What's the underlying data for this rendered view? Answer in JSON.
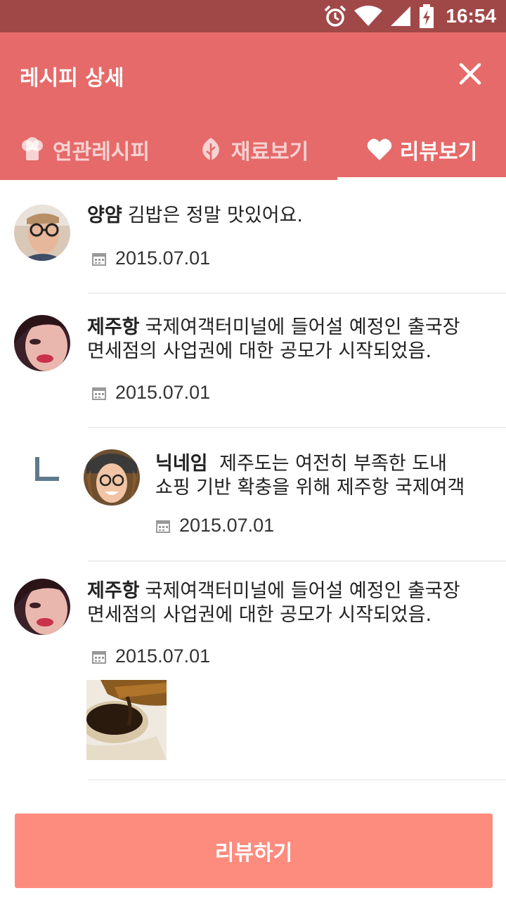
{
  "status_bar": {
    "time": "16:54"
  },
  "header": {
    "title": "레시피 상세",
    "close_icon": "close-icon"
  },
  "tabs": [
    {
      "label": "연관레시피",
      "icon": "chef-hat-icon",
      "active": false
    },
    {
      "label": "재료보기",
      "icon": "leaf-icon",
      "active": false
    },
    {
      "label": "리뷰보기",
      "icon": "heart-icon",
      "active": true
    }
  ],
  "reviews": [
    {
      "nickname": "양얌",
      "text": "김밥은 정말 맛있어요.",
      "date": "2015.07.01"
    },
    {
      "nickname": "제주항",
      "text_line1": "국제여객터미널에 들어설 예정인 출국장",
      "text_line2": "면세점의 사업권에 대한 공모가 시작되었음.",
      "date": "2015.07.01"
    },
    {
      "nickname": "닉네임",
      "text_line1": "제주도는 여전히 부족한 도내",
      "text_line2": "쇼핑 기반 확충을 위해 제주항 국제여객",
      "date": "2015.07.01",
      "is_reply": true
    },
    {
      "nickname": "제주항",
      "text_line1": "국제여객터미널에 들어설 예정인 출국장",
      "text_line2": "면세점의 사업권에 대한 공모가 시작되었음.",
      "date": "2015.07.01",
      "has_photo": true
    }
  ],
  "cta": {
    "label": "리뷰하기"
  },
  "colors": {
    "status_bar": "#a04848",
    "header": "#e56a69",
    "cta": "#fd8c7e"
  }
}
